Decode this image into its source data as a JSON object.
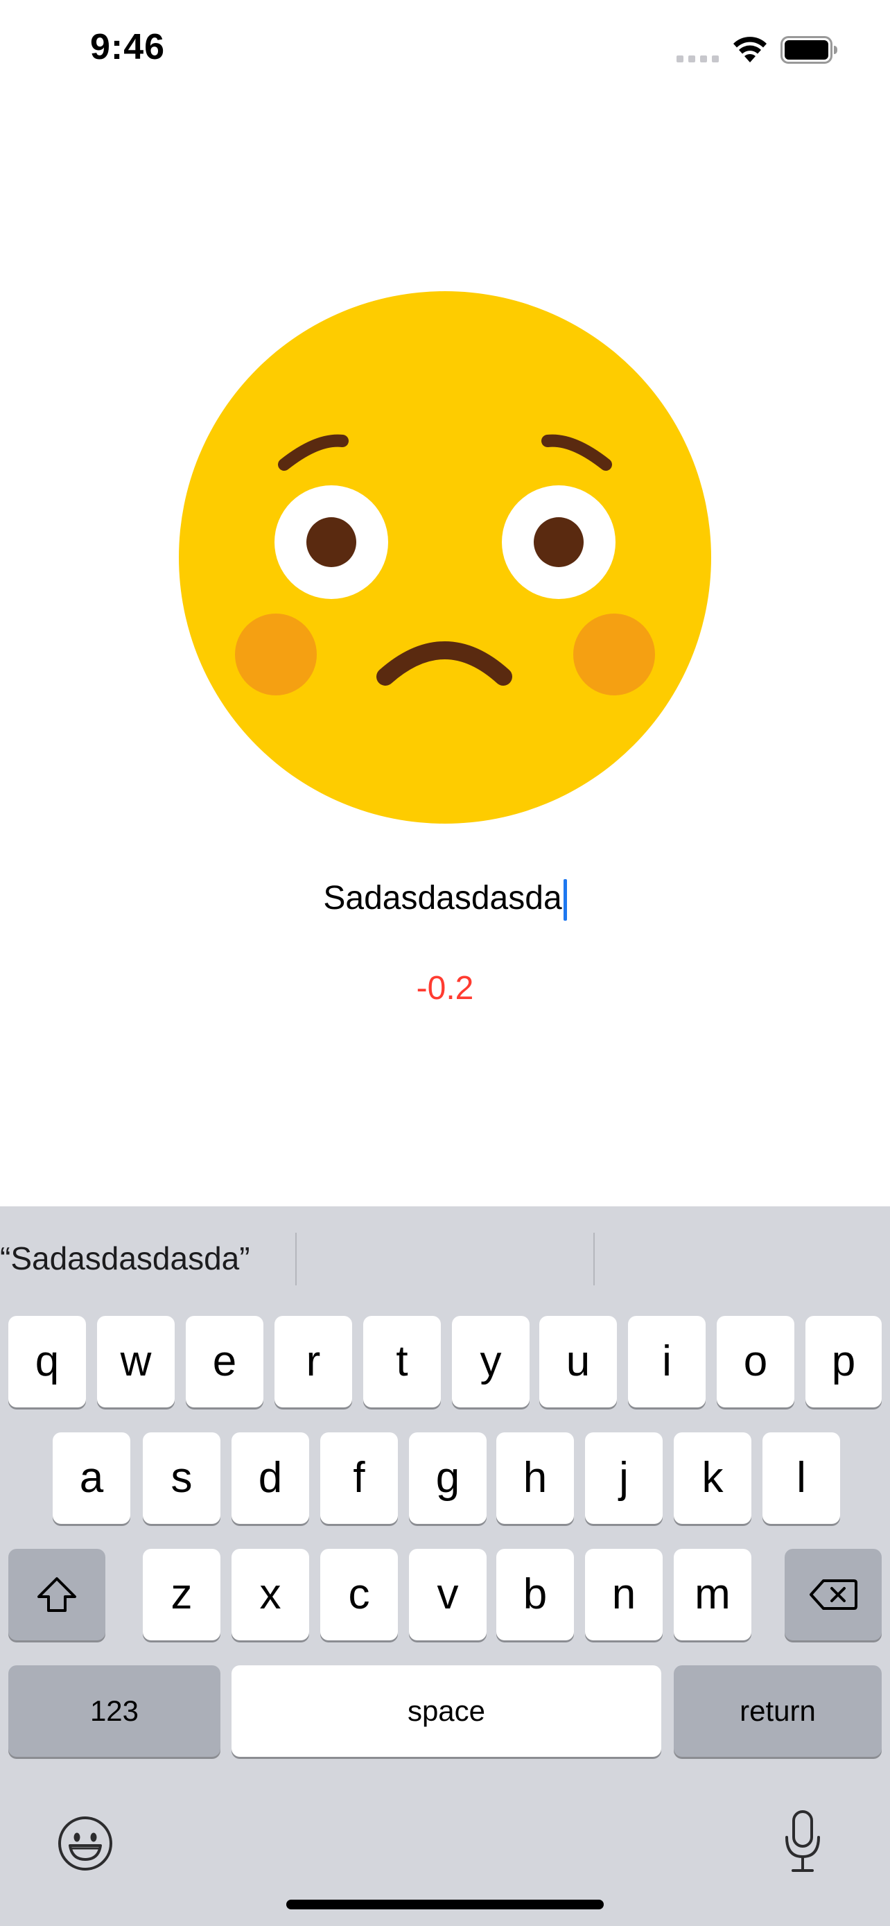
{
  "status_bar": {
    "time": "9:46"
  },
  "emoji": {
    "name": "worried-face-icon",
    "face_color": "#fecc00",
    "cheek_color": "#f5a012",
    "feature_color": "#5a2a10"
  },
  "input": {
    "value": "Sadasdasdasda"
  },
  "score": {
    "value": "-0.2",
    "color": "#ff3b30"
  },
  "keyboard": {
    "suggestions": [
      "“Sadasdasdasda”",
      "",
      ""
    ],
    "row1": [
      "q",
      "w",
      "e",
      "r",
      "t",
      "y",
      "u",
      "i",
      "o",
      "p"
    ],
    "row2": [
      "a",
      "s",
      "d",
      "f",
      "g",
      "h",
      "j",
      "k",
      "l"
    ],
    "row3": [
      "z",
      "x",
      "c",
      "v",
      "b",
      "n",
      "m"
    ],
    "numbers_label": "123",
    "space_label": "space",
    "return_label": "return"
  }
}
